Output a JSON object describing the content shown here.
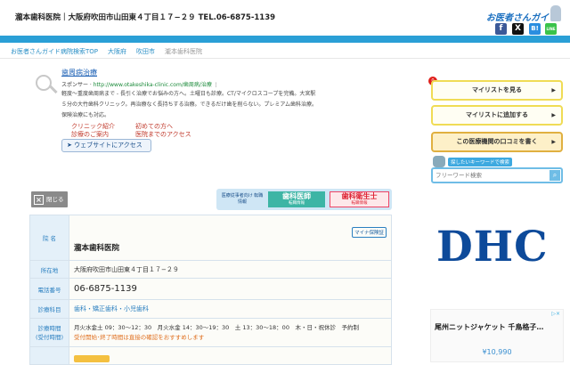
{
  "header": {
    "title": "瀧本歯科医院｜大阪府吹田市山田東４丁目１７−２９ TEL.06-6875-1139",
    "logo": "お医者さんガイド",
    "sns": [
      "f",
      "X",
      "B!",
      "LINE"
    ]
  },
  "breadcrumb": [
    "お医者さんガイド病院検索TOP",
    "大阪府",
    "吹田市",
    "瀧本歯科医院"
  ],
  "ad": {
    "title": "歯周病治療",
    "sponsor": "スポンサー ·",
    "url": "http://www.otakeshika-clinic.com/歯周病/治療",
    "more": "⋮",
    "description": "軽度〜重度歯周病まで - 長引く治療でお悩みの方へ。土曜日も診療。CT/マイクロスコープを完備。大宮駅５分の大竹歯科クリニック。再治療なく長持ちする治療。できるだけ歯を削らない。プレミアム歯科治療。保険治療にも対応。",
    "links": [
      "クリニック紹介",
      "初めての方へ",
      "診療のご案内",
      "医院までのアクセス"
    ],
    "button": "➤ ウェブサイトにアクセス"
  },
  "close_label": "閉じる",
  "recruit": {
    "label": "医療従事者向け 転職情報",
    "dentist": "歯科医師",
    "hygienist": "歯科衛生士",
    "sub": "転職情報"
  },
  "table": {
    "mynumber_badge": "マイナ保険証",
    "rows": [
      {
        "label": "院 名",
        "value": "瀧本歯科医院"
      },
      {
        "label": "所在地",
        "value": "大阪府吹田市山田東４丁目１７−２９"
      },
      {
        "label": "電話番号",
        "value": "06-6875-1139"
      },
      {
        "label": "診療科目",
        "value": "歯科・矯正歯科・小児歯科"
      },
      {
        "label": "診療時間\n(受付時間)",
        "value": "月火水金土 09：30〜12：30　月火水金 14：30〜19：30　土 13：30〜18：00　木・日・祝休診　予約制",
        "note": "受付開始･終了時間は直接の確認をおすすめします"
      }
    ]
  },
  "sidebar": {
    "badge": "0",
    "buttons": [
      "マイリストを見る",
      "マイリストに追加する",
      "この医療機関の口コミを書く"
    ],
    "search_label": "探したいキーワードで検索",
    "search_placeholder": "フリーワード検索"
  },
  "dhc_ad": "DHC",
  "product_ad": {
    "title": "尾州ニットジャケット 千鳥格子…",
    "price": "¥10,990"
  },
  "colors": {
    "accent": "#2a9fd6"
  }
}
